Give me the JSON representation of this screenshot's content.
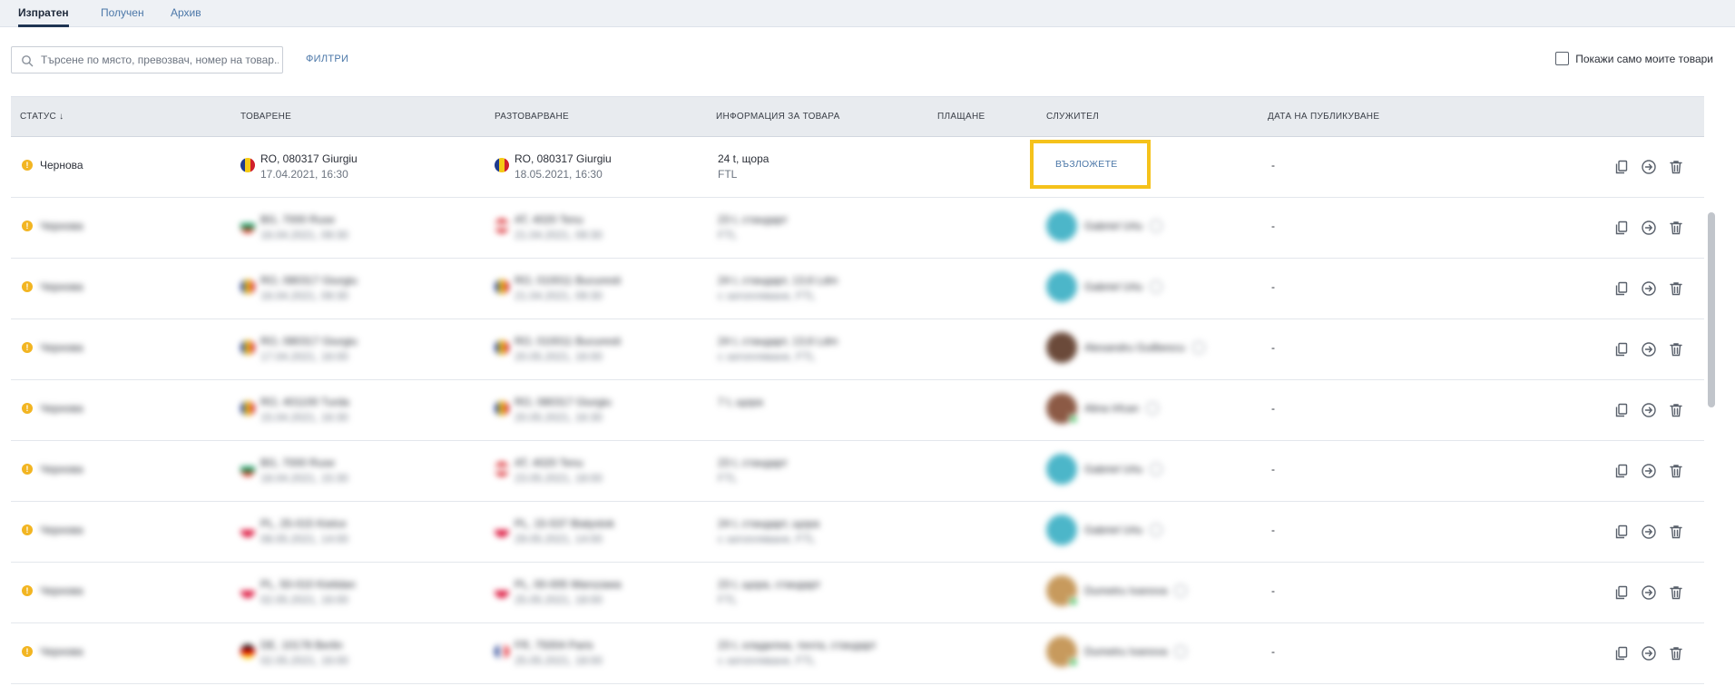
{
  "tabs": [
    {
      "label": "Изпратен",
      "active": true
    },
    {
      "label": "Получен",
      "active": false
    },
    {
      "label": "Архив",
      "active": false
    }
  ],
  "toolbar": {
    "search_placeholder": "Търсене по място, превозвач, номер на товар...",
    "search_value": "",
    "filters_label": "ФИЛТРИ",
    "my_cargo_label": "Покажи само моите товари",
    "my_cargo_checked": false
  },
  "table": {
    "columns": {
      "status": "СТАТУС ↓",
      "loading": "ТОВАРЕНЕ",
      "unloading": "РАЗТОВАРВАНЕ",
      "info": "ИНФОРМАЦИЯ ЗА ТОВАРА",
      "payment": "ПЛАЩАНЕ",
      "employee": "СЛУЖИТЕЛ",
      "published": "ДАТА НА ПУБЛИКУВАНЕ"
    },
    "rows": [
      {
        "status": "Чернова",
        "load_flag": "ro",
        "load_place": "RO, 080317 Giurgiu",
        "load_date": "17.04.2021, 16:30",
        "unload_flag": "ro",
        "unload_place": "RO, 080317 Giurgiu",
        "unload_date": "18.05.2021, 16:30",
        "info1": "24 t, щора",
        "info2": "FTL",
        "employee": "",
        "assign_label": "ВЪЗЛОЖЕТЕ",
        "published": "-",
        "blurred": false
      },
      {
        "status": "Чернова",
        "load_flag": "bg",
        "load_place": "BG, 7000 Ruse",
        "load_date": "16.04.2021, 09:30",
        "unload_flag": "at",
        "unload_place": "AT, 4020 Tenu",
        "unload_date": "21.04.2021, 09:30",
        "info1": "23 t, стандарт",
        "info2": "FTL",
        "employee": "Gabriel Urlu",
        "avatar": "teal",
        "online": false,
        "published": "-",
        "blurred": true
      },
      {
        "status": "Чернова",
        "load_flag": "ro",
        "load_place": "RO, 080317 Giurgiu",
        "load_date": "16.04.2021, 09:30",
        "unload_flag": "ro",
        "unload_place": "RO, 010011 Bucuresti",
        "unload_date": "21.04.2021, 09:30",
        "info1": "24 t, стандарт, 13,6 Ldm",
        "info2": "с затопляване, FTL",
        "employee": "Gabriel Urlu",
        "avatar": "teal",
        "online": false,
        "published": "-",
        "blurred": true
      },
      {
        "status": "Чернова",
        "load_flag": "ro",
        "load_place": "RO, 080317 Giurgiu",
        "load_date": "17.04.2021, 16:00",
        "unload_flag": "ro",
        "unload_place": "RO, 010011 Bucuresti",
        "unload_date": "20.05.2021, 16:00",
        "info1": "24 t, стандарт, 13,6 Ldm",
        "info2": "с затопляване, FTL",
        "employee": "Alexandru Guilbescu",
        "avatar": "dark",
        "online": false,
        "published": "-",
        "blurred": true
      },
      {
        "status": "Чернова",
        "load_flag": "ro",
        "load_place": "RO, 401100 Turda",
        "load_date": "15.04.2021, 16:30",
        "unload_flag": "ro",
        "unload_place": "RO, 080317 Giurgiu",
        "unload_date": "20.05.2021, 16:30",
        "info1": "7 t, щора",
        "info2": "",
        "employee": "Alina Irfcan",
        "avatar": "brown",
        "online": true,
        "published": "-",
        "blurred": true
      },
      {
        "status": "Чернова",
        "load_flag": "bg",
        "load_place": "BG, 7000 Ruse",
        "load_date": "18.04.2021, 15:30",
        "unload_flag": "at",
        "unload_place": "AT, 4020 Tenu",
        "unload_date": "23.05.2021, 18:00",
        "info1": "23 t, стандарт",
        "info2": "FTL",
        "employee": "Gabriel Urlu",
        "avatar": "teal",
        "online": false,
        "published": "-",
        "blurred": true
      },
      {
        "status": "Чернова",
        "load_flag": "pl",
        "load_place": "PL, 25-015 Kielce",
        "load_date": "08.05.2021, 14:00",
        "unload_flag": "pl",
        "unload_place": "PL, 15-537 Bialystok",
        "unload_date": "29.05.2021, 14:00",
        "info1": "24 t, стандарт, щора",
        "info2": "с затопляване, FTL",
        "employee": "Gabriel Urlu",
        "avatar": "teal",
        "online": false,
        "published": "-",
        "blurred": true
      },
      {
        "status": "Чернова",
        "load_flag": "pl",
        "load_place": "PL, 50-010 Kielidan",
        "load_date": "02.05.2021, 16:00",
        "unload_flag": "pl",
        "unload_place": "PL, 00-005 Warszawa",
        "unload_date": "25.05.2021, 18:00",
        "info1": "23 t, щора, стандарт",
        "info2": "FTL",
        "employee": "Dumetru Ivanova",
        "avatar": "tan",
        "online": true,
        "published": "-",
        "blurred": true
      },
      {
        "status": "Чернова",
        "load_flag": "de",
        "load_place": "DE, 10178 Berlin",
        "load_date": "02.05.2021, 16:00",
        "unload_flag": "fr",
        "unload_place": "FR, 75004 Paris",
        "unload_date": "25.05.2021, 18:00",
        "info1": "23 t, хладилна, тента, стандарт",
        "info2": "с затопляване, FTL",
        "employee": "Dumetru Ivanova",
        "avatar": "tan",
        "online": true,
        "published": "-",
        "blurred": true
      }
    ]
  },
  "flags": {
    "ro": [
      "#1f3b8f",
      "#f5c914",
      "#d0202c"
    ],
    "bg": [
      "#ffffff",
      "#169b62",
      "#d62612"
    ],
    "at": [
      "#d9262c",
      "#ffffff",
      "#d9262c"
    ],
    "pl": [
      "#ffffff",
      "#dc143c"
    ],
    "de": [
      "#111111",
      "#dd0000",
      "#ffce00"
    ],
    "fr": [
      "#1f3b8f",
      "#ffffff",
      "#e1202c"
    ]
  },
  "avatar_colors": {
    "teal": "#4cb6c9",
    "dark": "#6b4a3a",
    "brown": "#8c5a45",
    "tan": "#c79a5d"
  },
  "icons": {
    "search": "search-icon",
    "copy": "copy-icon",
    "send": "forward-icon",
    "delete": "trash-icon"
  },
  "colors": {
    "accent": "#4b77a8",
    "status_draft": "#f2b522",
    "highlight": "#f5c21b"
  }
}
